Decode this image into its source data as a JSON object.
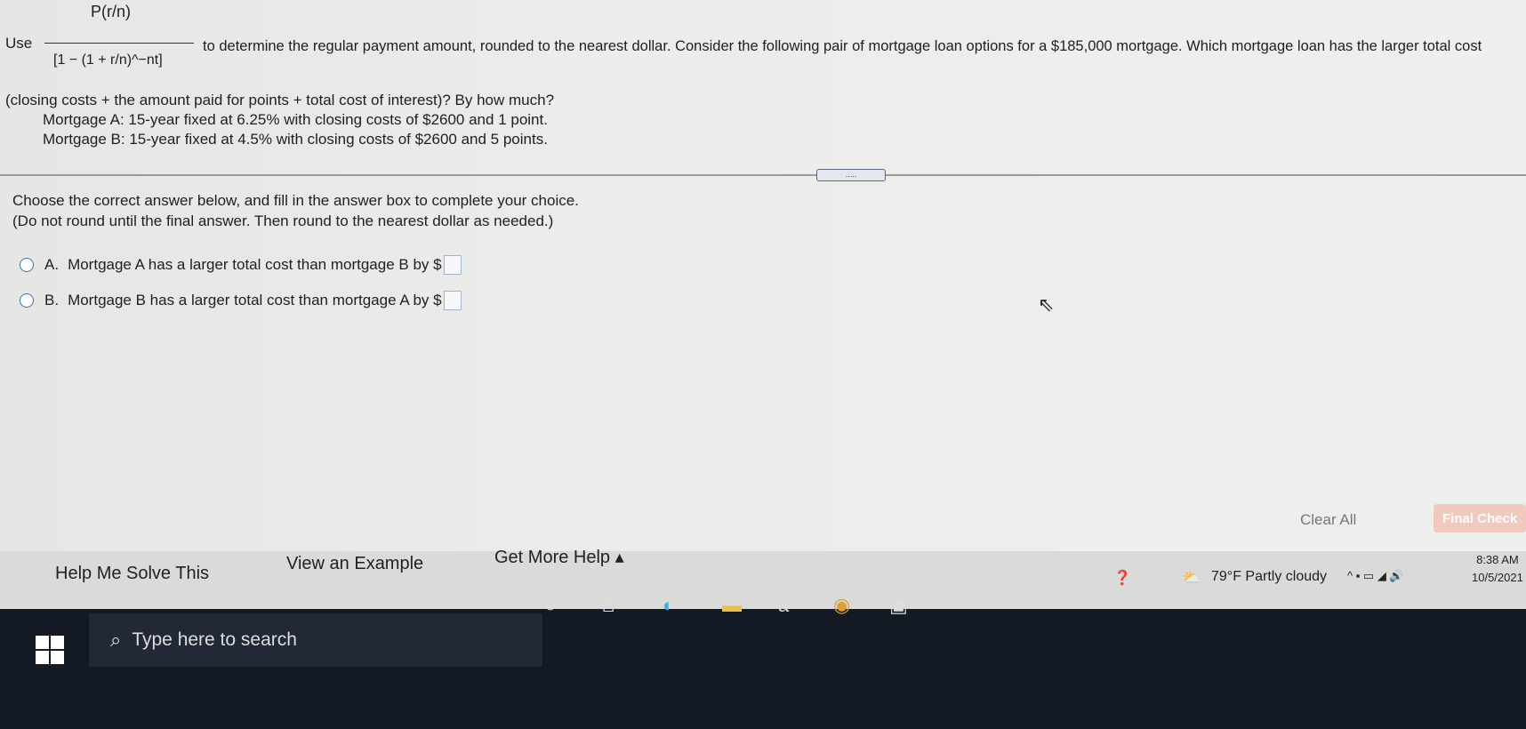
{
  "question": {
    "use_word": "Use",
    "formula_numerator": "P(r/n)",
    "formula_denominator": "[1 − (1 + r/n)^−nt]",
    "text_after_formula": "to determine the regular payment amount, rounded to the nearest dollar. Consider the following pair of mortgage loan options for a $185,000 mortgage. Which mortgage loan has the larger total cost",
    "text_line2": "(closing costs + the amount paid for points + total cost of interest)? By how much?",
    "mortgage_a": "Mortgage A: 15-year fixed at 6.25% with closing costs of $2600 and 1 point.",
    "mortgage_b": "Mortgage B: 15-year fixed at 4.5% with closing costs of $2600 and 5 points."
  },
  "separator_handle": ".....",
  "instructions": {
    "line1": "Choose the correct answer below, and fill in the answer box to complete your choice.",
    "line2": "(Do not round until the final answer. Then round to the nearest dollar as needed.)"
  },
  "choices": [
    {
      "letter": "A.",
      "text": "Mortgage A has a larger total cost than mortgage B by $"
    },
    {
      "letter": "B.",
      "text": "Mortgage B has a larger total cost than mortgage A by $"
    }
  ],
  "actions": {
    "clear_all": "Clear All",
    "final_check": "Final Check"
  },
  "help": {
    "help_me_solve": "Help Me Solve This",
    "view_example": "View an Example",
    "get_more_help": "Get More Help ▴"
  },
  "taskbar": {
    "search_placeholder": "Type here to search",
    "weather": "79°F  Partly cloudy",
    "time": "8:38 AM",
    "date": "10/5/2021"
  }
}
